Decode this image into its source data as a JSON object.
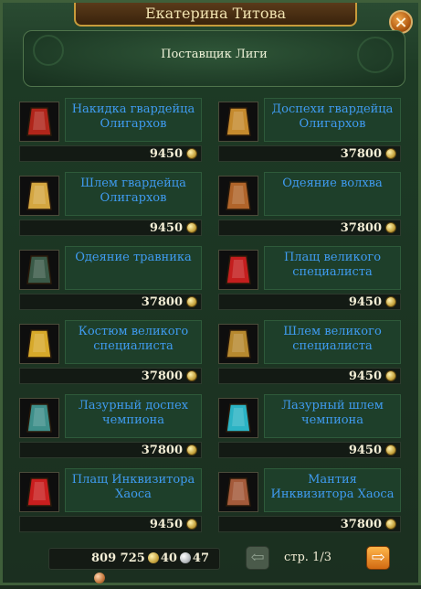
{
  "window": {
    "title": "Екатерина Титова",
    "merchant": "Поставщик Лиги"
  },
  "items": [
    {
      "name": "Накидка гвардейца Олигархов",
      "price": "9450",
      "icon": "red-cloak-icon",
      "color": "#b0251a"
    },
    {
      "name": "Доспехи гвардейца Олигархов",
      "price": "37800",
      "icon": "gold-armor-icon",
      "color": "#c58a2d"
    },
    {
      "name": "Шлем гвардейца Олигархов",
      "price": "9450",
      "icon": "gold-helmet-icon",
      "color": "#d4a640"
    },
    {
      "name": "Одеяние волхва",
      "price": "37800",
      "icon": "vest-icon",
      "color": "#b0642a"
    },
    {
      "name": "Одеяние травника",
      "price": "37800",
      "icon": "dark-armor-icon",
      "color": "#3a5a48"
    },
    {
      "name": "Плащ великого специалиста",
      "price": "9450",
      "icon": "red-cloak-icon",
      "color": "#c41e1e"
    },
    {
      "name": "Костюм великого специалиста",
      "price": "37800",
      "icon": "gold-suit-icon",
      "color": "#d7a92a"
    },
    {
      "name": "Шлем великого специалиста",
      "price": "9450",
      "icon": "hood-helmet-icon",
      "color": "#b7892f"
    },
    {
      "name": "Лазурный доспех чемпиона",
      "price": "37800",
      "icon": "azure-armor-icon",
      "color": "#3e8f8a"
    },
    {
      "name": "Лазурный шлем чемпиона",
      "price": "9450",
      "icon": "azure-helmet-icon",
      "color": "#2bb3c4"
    },
    {
      "name": "Плащ Инквизитора Хаоса",
      "price": "9450",
      "icon": "red-cloak-icon",
      "color": "#c91e1e"
    },
    {
      "name": "Мантия Инквизитора Хаоса",
      "price": "37800",
      "icon": "robe-icon",
      "color": "#a45a3a"
    }
  ],
  "footer": {
    "gold": "809 725",
    "silver": "40",
    "copper": "47",
    "page": "стр. 1/3"
  }
}
